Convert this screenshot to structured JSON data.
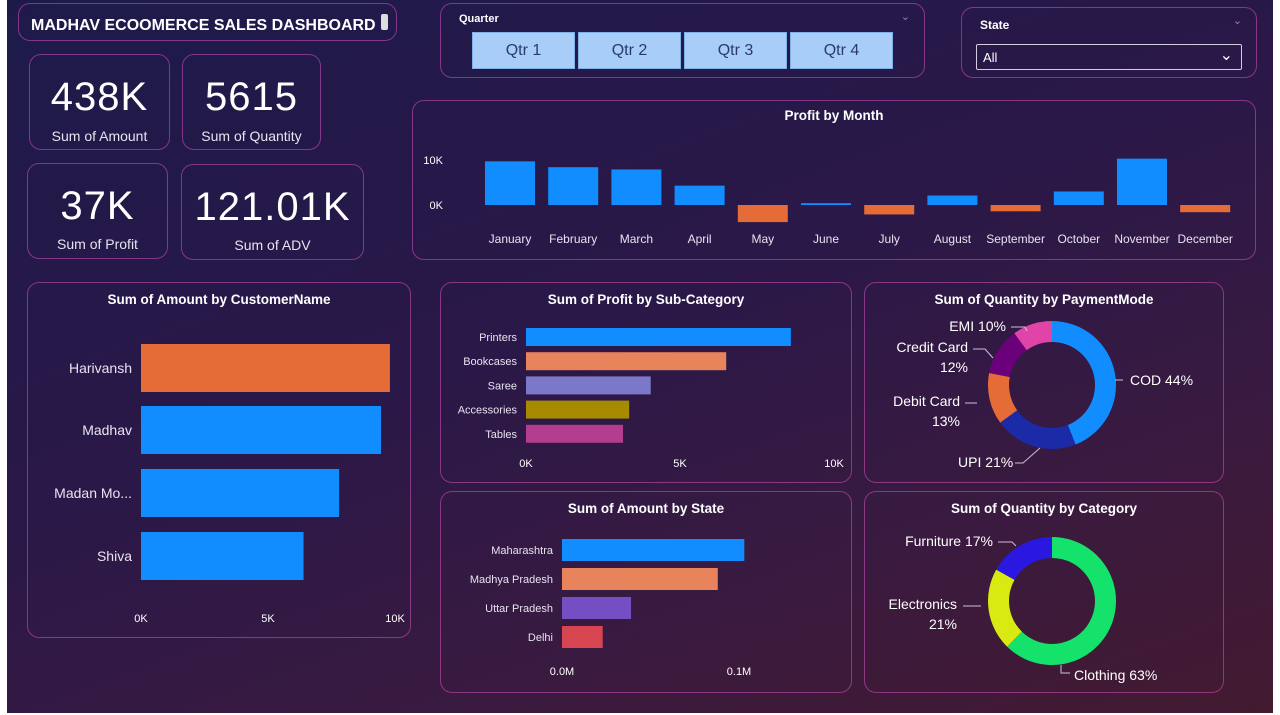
{
  "dashboard": {
    "title": "MADHAV ECOOMERCE SALES DASHBOARD"
  },
  "kpis": [
    {
      "value": "438K",
      "label": "Sum of Amount"
    },
    {
      "value": "5615",
      "label": "Sum of Quantity"
    },
    {
      "value": "37K",
      "label": "Sum of Profit"
    },
    {
      "value": "121.01K",
      "label": "Sum of ADV"
    }
  ],
  "slicers": {
    "quarter": {
      "label": "Quarter",
      "options": [
        "Qtr 1",
        "Qtr 2",
        "Qtr 3",
        "Qtr 4"
      ]
    },
    "state": {
      "label": "State",
      "selected": "All"
    }
  },
  "colors": {
    "blue": "#118DFF",
    "orange": "#E66C37",
    "panel_border": "#D650BE"
  },
  "chart_data": [
    {
      "id": "profit_by_month",
      "type": "bar",
      "title": "Profit by Month",
      "categories": [
        "January",
        "February",
        "March",
        "April",
        "May",
        "June",
        "July",
        "August",
        "September",
        "October",
        "November",
        "December"
      ],
      "values": [
        9700,
        8400,
        7900,
        4300,
        -3800,
        400,
        -2100,
        2100,
        -1400,
        3000,
        10300,
        -1600
      ],
      "y_ticks": [
        "10K",
        "0K"
      ],
      "ylim": [
        -5000,
        12000
      ]
    },
    {
      "id": "amount_by_customer",
      "type": "bar",
      "orientation": "horizontal",
      "title": "Sum of Amount by CustomerName",
      "categories": [
        "Harivansh",
        "Madhav",
        "Madan Mo...",
        "Shiva"
      ],
      "values": [
        9800,
        9450,
        7800,
        6400
      ],
      "x_ticks": [
        "0K",
        "5K",
        "10K"
      ],
      "xlim": [
        0,
        10000
      ]
    },
    {
      "id": "profit_by_subcategory",
      "type": "bar",
      "orientation": "horizontal",
      "title": "Sum of Profit by Sub-Category",
      "categories": [
        "Printers",
        "Bookcases",
        "Saree",
        "Accessories",
        "Tables"
      ],
      "values": [
        8600,
        6500,
        4050,
        3350,
        3150
      ],
      "colors": [
        "#118DFF",
        "#E8845C",
        "#7B77C9",
        "#A68A00",
        "#B33D8E"
      ],
      "x_ticks": [
        "0K",
        "5K",
        "10K"
      ],
      "xlim": [
        0,
        10000
      ]
    },
    {
      "id": "amount_by_state",
      "type": "bar",
      "orientation": "horizontal",
      "title": "Sum of Amount by State",
      "categories": [
        "Maharashtra",
        "Madhya Pradesh",
        "Uttar Pradesh",
        "Delhi"
      ],
      "values": [
        0.103,
        0.088,
        0.039,
        0.023
      ],
      "colors": [
        "#118DFF",
        "#E8845C",
        "#744EC2",
        "#D64550"
      ],
      "x_ticks": [
        "0.0M",
        "0.1M"
      ],
      "xlim": [
        0,
        0.1
      ]
    },
    {
      "id": "quantity_by_paymentmode",
      "type": "pie",
      "donut": true,
      "title": "Sum of Quantity by PaymentMode",
      "slices": [
        {
          "label": "COD 44%",
          "value": 44,
          "color": "#118DFF"
        },
        {
          "label": "UPI 21%",
          "value": 21,
          "color": "#1B2AA6"
        },
        {
          "label": "Debit Card 13%",
          "value": 13,
          "color": "#E66C37"
        },
        {
          "label": "Credit Card 12%",
          "value": 12,
          "color": "#6B007B"
        },
        {
          "label": "EMI 10%",
          "value": 10,
          "color": "#E044A7"
        }
      ]
    },
    {
      "id": "quantity_by_category",
      "type": "pie",
      "donut": true,
      "title": "Sum of Quantity by Category",
      "slices": [
        {
          "label": "Clothing 63%",
          "value": 63,
          "color": "#15E26A"
        },
        {
          "label": "Electronics 21%",
          "value": 21,
          "color": "#D9EA12"
        },
        {
          "label": "Furniture 17%",
          "value": 17,
          "color": "#2A17E0"
        }
      ]
    }
  ]
}
